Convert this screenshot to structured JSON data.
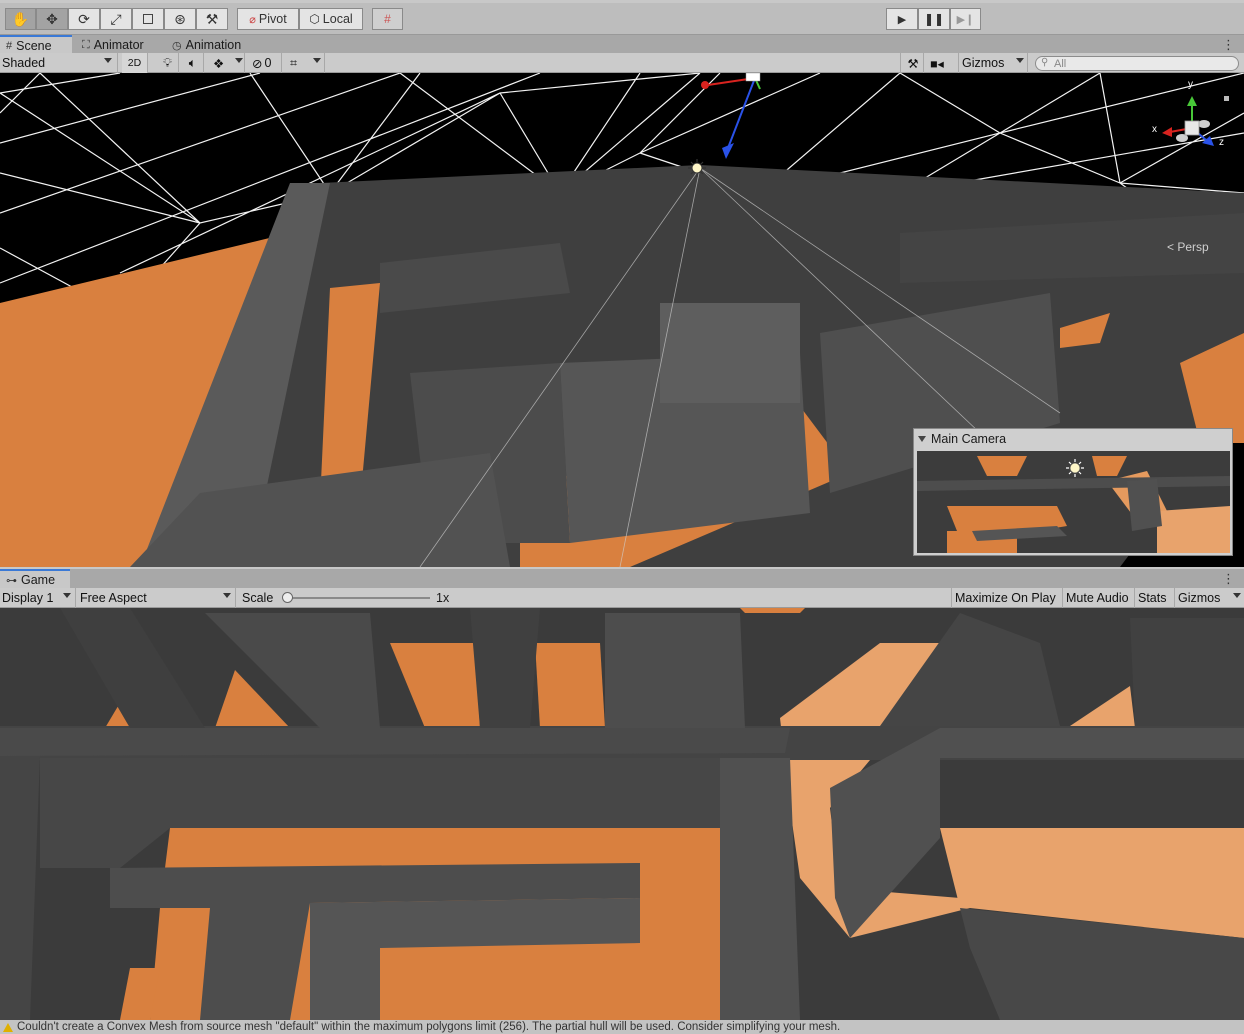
{
  "toolbar": {
    "pivot_label": "Pivot",
    "local_label": "Local"
  },
  "scene_tabs": [
    {
      "label": "Scene"
    },
    {
      "label": "Animator"
    },
    {
      "label": "Animation"
    }
  ],
  "scene_controls": {
    "shading_mode": "Shaded",
    "mode_2d": "2D",
    "hidden_count": "0",
    "gizmos_label": "Gizmos",
    "search_placeholder": "All",
    "projection_label": "< Persp"
  },
  "camera_preview": {
    "title": "Main Camera"
  },
  "game_tab": {
    "label": "Game"
  },
  "game_controls": {
    "display": "Display 1",
    "aspect": "Free Aspect",
    "scale_label": "Scale",
    "scale_value": "1x",
    "scale_fraction": 0.0,
    "maximize_label": "Maximize On Play",
    "mute_label": "Mute Audio",
    "stats_label": "Stats",
    "gizmos_label": "Gizmos"
  },
  "gizmo_axes": {
    "y": "y",
    "x": "x",
    "z": "z"
  },
  "status": {
    "message": "Couldn't create a Convex Mesh from source mesh \"default\" within the maximum polygons limit (256). The partial hull will be used. Consider simplifying your mesh."
  },
  "colors": {
    "floor_orange": "#d9803f",
    "wall_dark": "#4a4a4a",
    "skybox": "#000000",
    "accent_tab": "#3a79d6"
  }
}
